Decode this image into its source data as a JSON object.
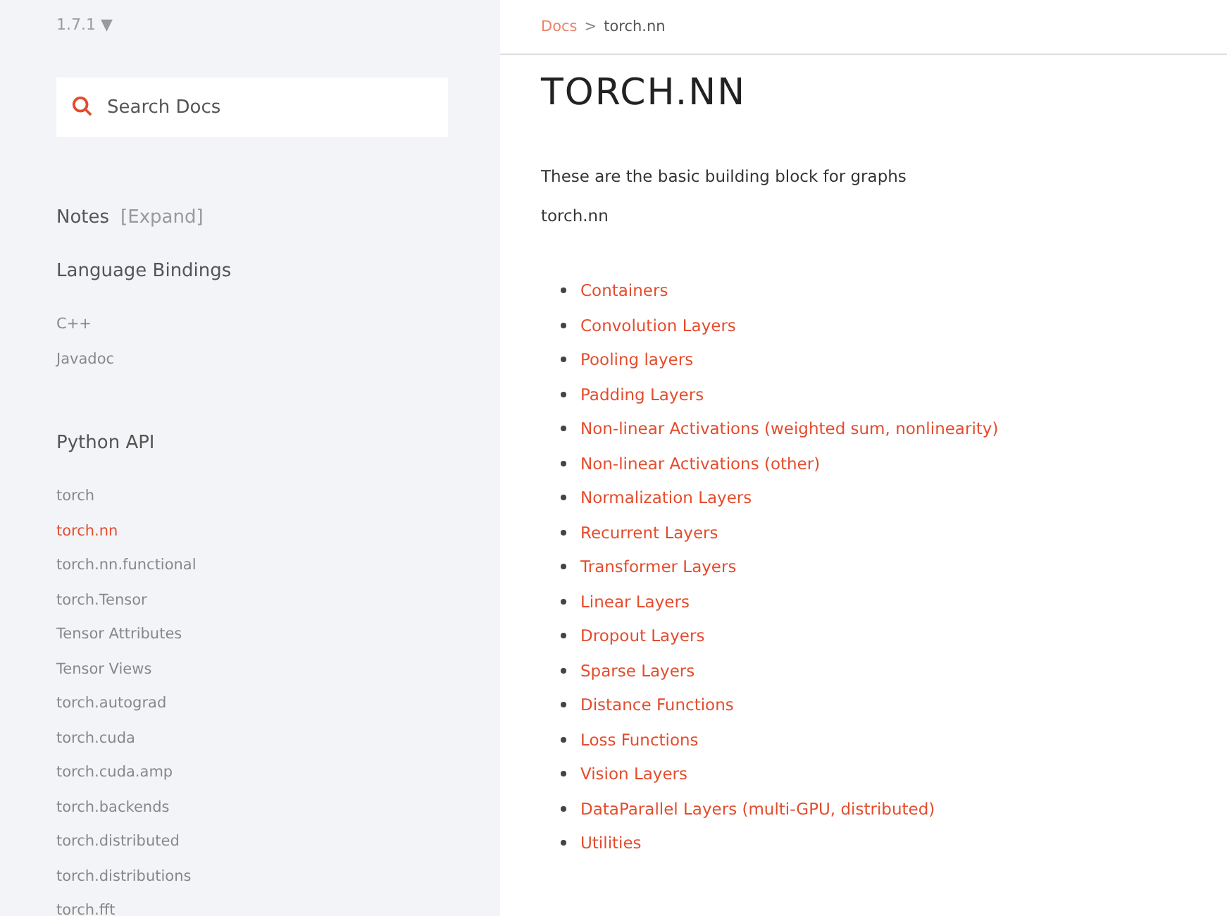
{
  "sidebar": {
    "version": "1.7.1",
    "version_caret": "▼",
    "search": {
      "placeholder": "Search Docs"
    },
    "notes": {
      "label": "Notes",
      "toggle": "[Expand]"
    },
    "sections": [
      {
        "heading": "Language Bindings",
        "items": [
          {
            "label": "C++",
            "selected": false
          },
          {
            "label": "Javadoc",
            "selected": false
          }
        ]
      },
      {
        "heading": "Python API",
        "items": [
          {
            "label": "torch",
            "selected": false
          },
          {
            "label": "torch.nn",
            "selected": true
          },
          {
            "label": "torch.nn.functional",
            "selected": false
          },
          {
            "label": "torch.Tensor",
            "selected": false
          },
          {
            "label": "Tensor Attributes",
            "selected": false
          },
          {
            "label": "Tensor Views",
            "selected": false
          },
          {
            "label": "torch.autograd",
            "selected": false
          },
          {
            "label": "torch.cuda",
            "selected": false
          },
          {
            "label": "torch.cuda.amp",
            "selected": false
          },
          {
            "label": "torch.backends",
            "selected": false
          },
          {
            "label": "torch.distributed",
            "selected": false
          },
          {
            "label": "torch.distributions",
            "selected": false
          },
          {
            "label": "torch.fft",
            "selected": false
          }
        ]
      }
    ]
  },
  "breadcrumb": {
    "link": "Docs",
    "separator": ">",
    "current": "torch.nn"
  },
  "title": "TORCH.NN",
  "intro": "These are the basic building block for graphs",
  "module": "torch.nn",
  "links": [
    "Containers",
    "Convolution Layers",
    "Pooling layers",
    "Padding Layers",
    "Non-linear Activations (weighted sum, nonlinearity)",
    "Non-linear Activations (other)",
    "Normalization Layers",
    "Recurrent Layers",
    "Transformer Layers",
    "Linear Layers",
    "Dropout Layers",
    "Sparse Layers",
    "Distance Functions",
    "Loss Functions",
    "Vision Layers",
    "DataParallel Layers (multi-GPU, distributed)",
    "Utilities"
  ]
}
